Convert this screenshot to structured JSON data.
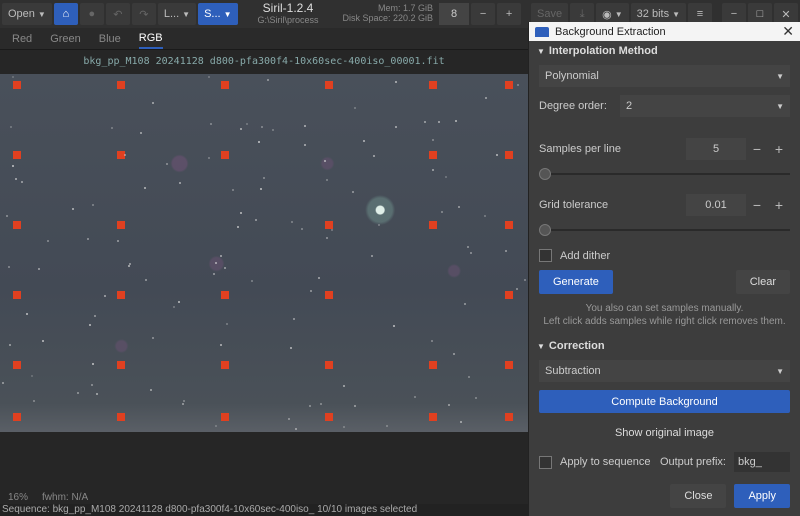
{
  "toolbar": {
    "open": "Open",
    "l_btn": "L...",
    "s_btn": "S...",
    "zoom_value": "8",
    "save": "Save",
    "bits": "32 bits"
  },
  "header": {
    "title": "Siril-1.2.4",
    "path": "G:\\Siril\\process",
    "mem": "Mem: 1.7 GiB",
    "disk": "Disk Space: 220.2 GiB"
  },
  "tabs": {
    "red": "Red",
    "green": "Green",
    "blue": "Blue",
    "rgb": "RGB"
  },
  "file": "bkg_pp_M108 20241128 d800-pfa300f4-10x60sec-400iso_00001.fit",
  "status": {
    "zoom": "16%",
    "fwhm_label": "fwhm:",
    "fwhm_value": "N/A"
  },
  "sequence": "Sequence: bkg_pp_M108 20241128 d800-pfa300f4-10x60sec-400iso_ 10/10 images selected",
  "panel": {
    "title": "Background Extraction",
    "interp_h": "Interpolation Method",
    "method": "Polynomial",
    "degree_label": "Degree order:",
    "degree": "2",
    "spl_label": "Samples per line",
    "spl_value": "5",
    "tol_label": "Grid tolerance",
    "tol_value": "0.01",
    "dither": "Add dither",
    "generate": "Generate",
    "clear": "Clear",
    "hint1": "You also can set samples manually.",
    "hint2": "Left click adds samples while right click removes them.",
    "corr_h": "Correction",
    "corr_method": "Subtraction",
    "compute": "Compute Background",
    "show_orig": "Show original image",
    "apply_seq": "Apply to sequence",
    "prefix_label": "Output prefix:",
    "prefix_value": "bkg_",
    "close": "Close",
    "apply": "Apply"
  }
}
